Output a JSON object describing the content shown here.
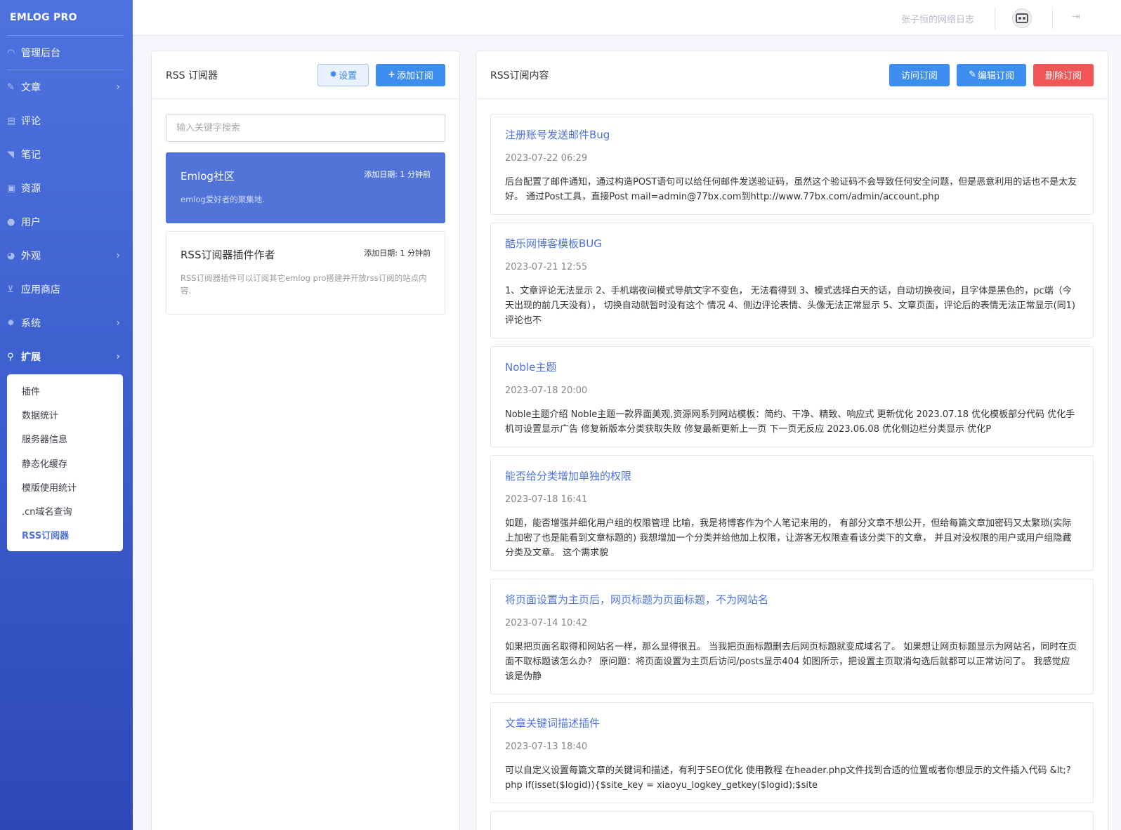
{
  "brand": "EMLOG PRO",
  "nav": {
    "dashboard": "管理后台",
    "items": [
      {
        "label": "文章",
        "chev": "›"
      },
      {
        "label": "评论",
        "chev": ""
      },
      {
        "label": "笔记",
        "chev": ""
      },
      {
        "label": "资源",
        "chev": ""
      },
      {
        "label": "用户",
        "chev": ""
      },
      {
        "label": "外观",
        "chev": "›"
      },
      {
        "label": "应用商店",
        "chev": ""
      },
      {
        "label": "系统",
        "chev": "›"
      },
      {
        "label": "扩展",
        "chev": "›"
      }
    ],
    "submenu": [
      "插件",
      "数据统计",
      "服务器信息",
      "静态化缓存",
      "模版使用统计",
      ".cn域名查询",
      "RSS订阅器"
    ]
  },
  "topbar": {
    "site_name": "张子恒的网络日志"
  },
  "left_panel": {
    "title": "RSS 订阅器",
    "settings_btn": "设置",
    "add_btn": "添加订阅",
    "search_placeholder": "输入关键字搜索",
    "feeds": [
      {
        "name": "Emlog社区",
        "date": "添加日期: 1 分钟前",
        "desc": "emlog爱好者的聚集地."
      },
      {
        "name": "RSS订阅器插件作者",
        "date": "添加日期: 1 分钟前",
        "desc": "RSS订阅器插件可以订阅其它emlog pro搭建并开放rss订阅的站点内容."
      }
    ]
  },
  "right_panel": {
    "title": "RSS订阅内容",
    "visit_btn": "访问订阅",
    "edit_btn": "编辑订阅",
    "delete_btn": "删除订阅",
    "articles": [
      {
        "title": "注册账号发送邮件Bug",
        "date": "2023-07-22 06:29",
        "body": "后台配置了邮件通知，通过构造POST语句可以给任何邮件发送验证码，虽然这个验证码不会导致任何安全问题，但是恶意利用的话也不是太友好。 通过Post工具，直接Post mail=admin@77bx.com到http://www.77bx.com/admin/account.php"
      },
      {
        "title": "酷乐网博客模板BUG",
        "date": "2023-07-21 12:55",
        "body": "1、文章评论无法显示 2、手机端夜间模式导航文字不变色， 无法看得到 3、模式选择白天的话，自动切换夜间，且字体是黑色的，pc端（今天出现的前几天没有）， 切换自动就暂时没有这个 情况 4、侧边评论表情、头像无法正常显示 5、文章页面，评论后的表情无法正常显示(同1)评论也不"
      },
      {
        "title": "Noble主题",
        "date": "2023-07-18 20:00",
        "body": "Noble主题介绍 Noble主题一款界面美观,资源网系列网站模板：简约、干净、精致、响应式 更新优化 2023.07.18 优化模板部分代码 优化手机可设置显示广告 修复新版本分类获取失败 修复最新更新上一页 下一页无反应 2023.06.08 优化侧边栏分类显示 优化P"
      },
      {
        "title": "能否给分类增加单独的权限",
        "date": "2023-07-18 16:41",
        "body": "如题，能否增强并细化用户组的权限管理 比喻，我是将博客作为个人笔记来用的， 有部分文章不想公开，但给每篇文章加密码又太繁琐(实际上加密了也是能看到文章标题的) 我想增加一个分类并给他加上权限，让游客无权限查看该分类下的文章， 并且对没权限的用户或用户组隐藏分类及文章。 这个需求貌"
      },
      {
        "title": "将页面设置为主页后，网页标题为页面标题，不为网站名",
        "date": "2023-07-14 10:42",
        "body": "如果把页面名取得和网站名一样，那么显得很丑。 当我把页面标题删去后网页标题就变成域名了。 如果想让网页标题显示为网站名，同时在页面不取标题该怎么办？ 原问题：将页面设置为主页后访问/posts显示404 如图所示，把设置主页取消勾选后就都可以正常访问了。 我感觉应该是伪静"
      },
      {
        "title": "文章关键词描述插件",
        "date": "2023-07-13 18:40",
        "body": "可以自定义设置每篇文章的关键词和描述，有利于SEO优化 使用教程 在header.php文件找到合适的位置或者你想显示的文件插入代码 &lt;?php if(isset($logid)){$site_key = xiaoyu_logkey_getkey($logid);$site"
      }
    ]
  }
}
